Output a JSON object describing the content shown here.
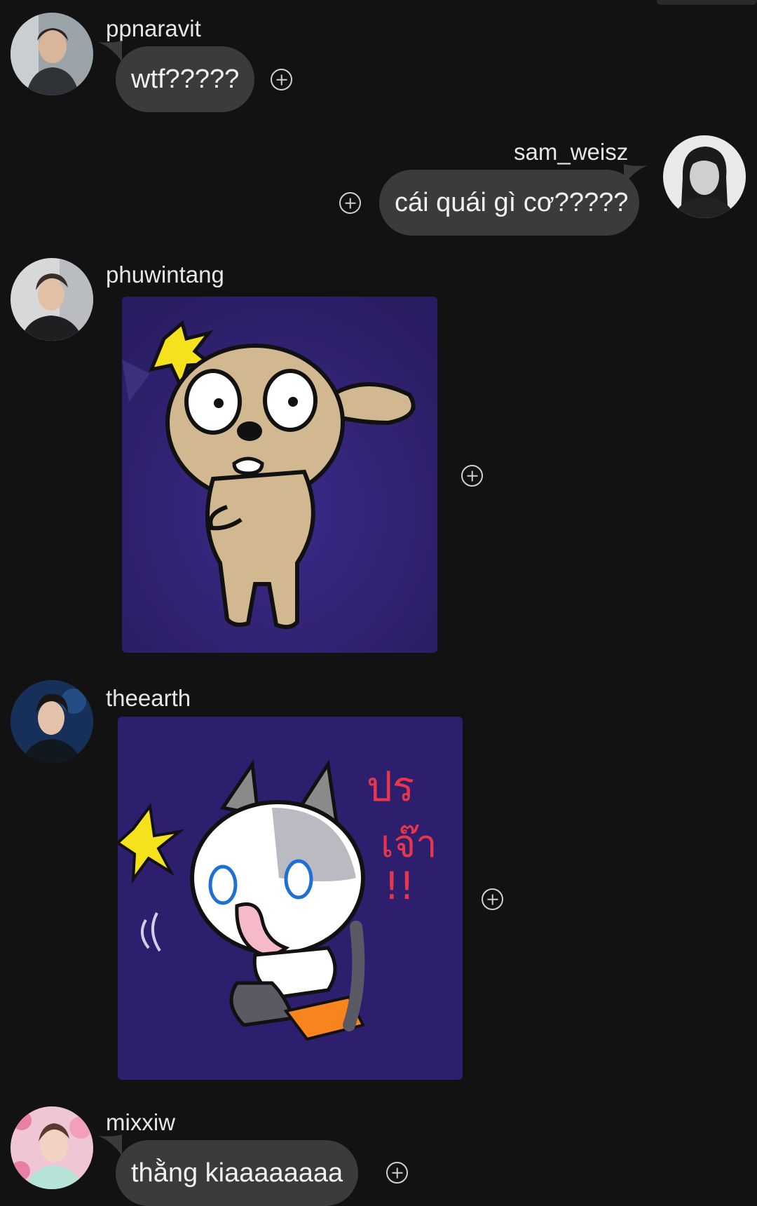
{
  "messages": [
    {
      "user": "ppnaravit",
      "type": "text",
      "text": "wtf?????",
      "side": "left"
    },
    {
      "user": "sam_weisz",
      "type": "text",
      "text": "cái quái gì cơ?????",
      "side": "right"
    },
    {
      "user": "phuwintang",
      "type": "sticker",
      "sticker": "puppy-shocked-sticker",
      "side": "left"
    },
    {
      "user": "theearth",
      "type": "sticker",
      "sticker": "cat-startled-sticker",
      "side": "left",
      "sticker_text": "ประเจ๊า!!"
    },
    {
      "user": "mixxiw",
      "type": "text",
      "text": "thằng kiaaaaaaaa",
      "side": "left"
    }
  ],
  "icons": {
    "reaction": "add-reaction-icon"
  },
  "colors": {
    "background": "#121212",
    "bubble": "#3b3b3b",
    "sticker_bg": "#2e1f6e"
  }
}
